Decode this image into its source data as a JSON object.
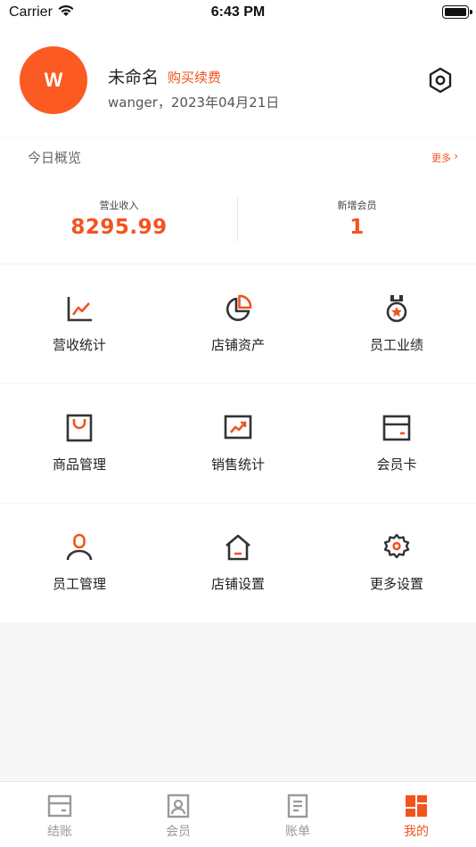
{
  "status_bar": {
    "carrier": "Carrier",
    "time": "6:43 PM"
  },
  "profile": {
    "avatar_letter": "W",
    "name": "未命名",
    "renew_link": "购买续费",
    "subtitle": "wanger，2023年04月21日"
  },
  "overview": {
    "title": "今日概览",
    "more": "更多",
    "stats": [
      {
        "label": "营业收入",
        "value": "8295.99"
      },
      {
        "label": "新增会员",
        "value": "1"
      }
    ]
  },
  "grid": [
    {
      "label": "营收统计",
      "icon": "trend-chart-icon"
    },
    {
      "label": "店铺资产",
      "icon": "pie-chart-icon"
    },
    {
      "label": "员工业绩",
      "icon": "medal-icon"
    },
    {
      "label": "商品管理",
      "icon": "shopping-bag-icon"
    },
    {
      "label": "销售统计",
      "icon": "sales-chart-icon"
    },
    {
      "label": "会员卡",
      "icon": "card-icon"
    },
    {
      "label": "员工管理",
      "icon": "person-icon"
    },
    {
      "label": "店铺设置",
      "icon": "home-icon"
    },
    {
      "label": "更多设置",
      "icon": "gear-icon"
    }
  ],
  "tabbar": [
    {
      "label": "结账",
      "icon": "checkout-icon",
      "active": false
    },
    {
      "label": "会员",
      "icon": "member-icon",
      "active": false
    },
    {
      "label": "账单",
      "icon": "bill-icon",
      "active": false
    },
    {
      "label": "我的",
      "icon": "mine-grid-icon",
      "active": true
    }
  ],
  "colors": {
    "accent": "#f0551f",
    "avatar_bg": "#fb5a22",
    "icon_dark": "#333333",
    "inactive": "#999999"
  }
}
